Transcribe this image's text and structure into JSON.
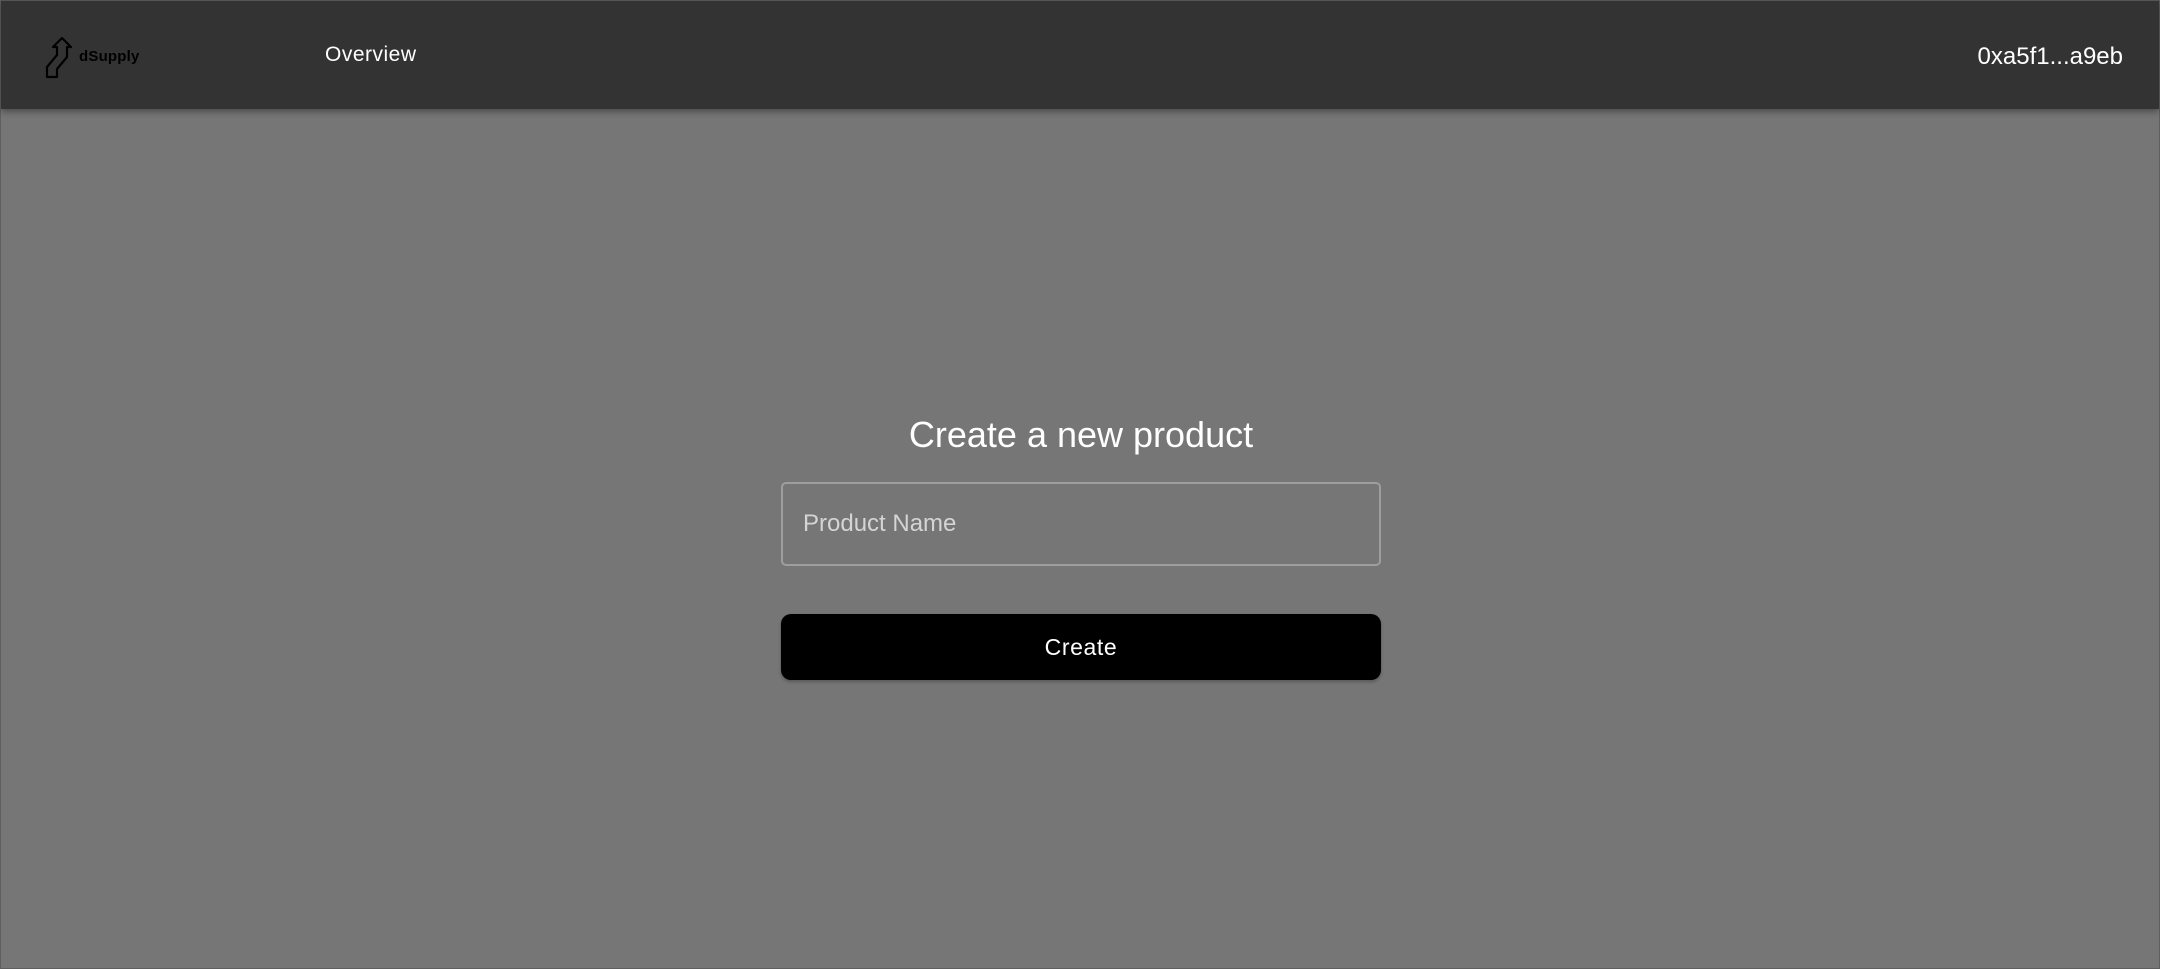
{
  "brand": {
    "name": "dSupply",
    "logo_icon": "arrow-up-path-icon"
  },
  "nav": {
    "links": [
      {
        "label": "Overview"
      }
    ]
  },
  "account": {
    "address": "0xa5f1...a9eb"
  },
  "form": {
    "title": "Create a new product",
    "product_name_placeholder": "Product Name",
    "product_name_value": "",
    "submit_label": "Create"
  },
  "colors": {
    "navbar": "#333333",
    "background": "#767676",
    "button": "#000000",
    "text": "#ffffff"
  }
}
